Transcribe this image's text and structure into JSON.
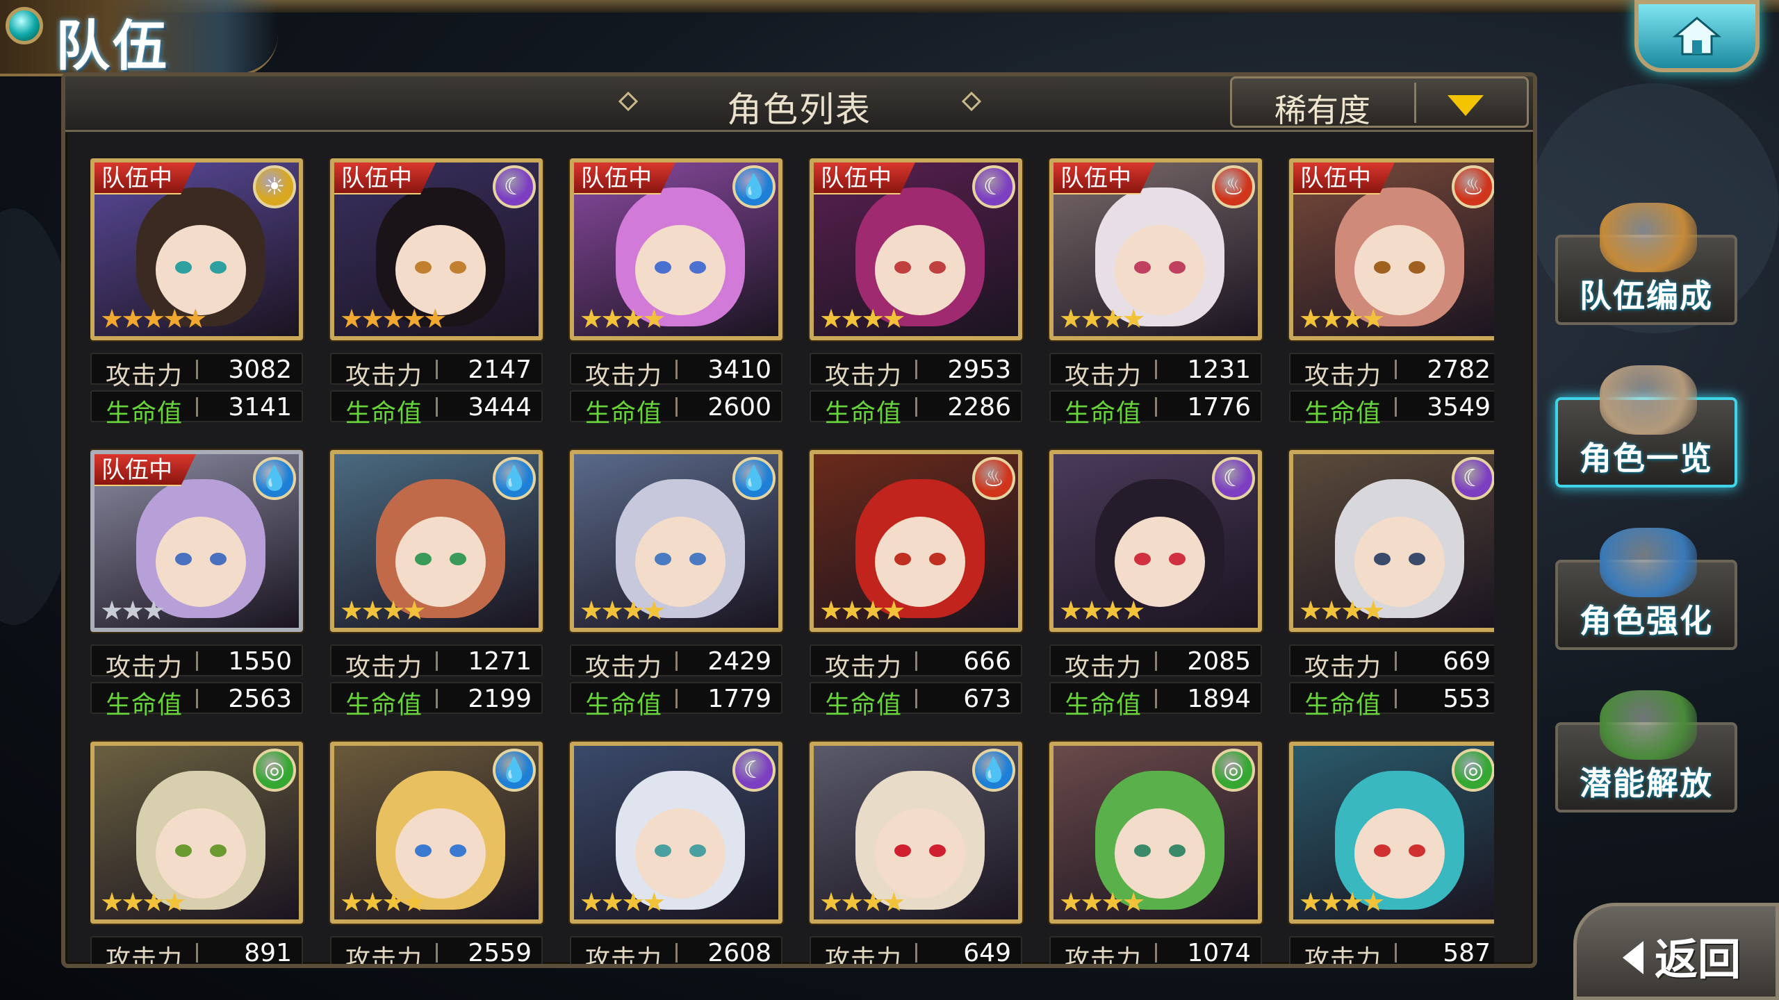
{
  "screen": {
    "title": "队伍"
  },
  "panel": {
    "title": "角色列表",
    "sort_label": "稀有度"
  },
  "party_badge_text": "队伍中",
  "stat_labels": {
    "attack": "攻击力",
    "hp": "生命值"
  },
  "element_icons": {
    "light": "☀",
    "dark": "☾",
    "water": "💧",
    "fire": "♨",
    "wind": "◎"
  },
  "element_colors": {
    "light": "#d9a820",
    "dark": "#7d3fc2",
    "water": "#1e7fd6",
    "fire": "#d0351c",
    "wind": "#34a832"
  },
  "characters": [
    {
      "element": "light",
      "stars": 5,
      "in_party": true,
      "attack": "3082",
      "hp": "3141",
      "hair": "#3a2a22",
      "eye": "#2ea0a0",
      "bg": "#5a4a9a"
    },
    {
      "element": "dark",
      "stars": 5,
      "in_party": true,
      "attack": "2147",
      "hp": "3444",
      "hair": "#1a1418",
      "eye": "#c08030",
      "bg": "#3a3060"
    },
    {
      "element": "water",
      "stars": 4,
      "in_party": true,
      "attack": "3410",
      "hp": "2600",
      "hair": "#d27ad8",
      "eye": "#4a70d0",
      "bg": "#8a4aa0"
    },
    {
      "element": "dark",
      "stars": 4,
      "in_party": true,
      "attack": "2953",
      "hp": "2286",
      "hair": "#a02a70",
      "eye": "#c04040",
      "bg": "#5a2050"
    },
    {
      "element": "fire",
      "stars": 4,
      "in_party": true,
      "attack": "1231",
      "hp": "1776",
      "hair": "#e8dfe6",
      "eye": "#c04060",
      "bg": "#7a6a6a"
    },
    {
      "element": "fire",
      "stars": 4,
      "in_party": true,
      "attack": "2782",
      "hp": "3549",
      "hair": "#d08a7a",
      "eye": "#a06020",
      "bg": "#7a4a3a"
    },
    {
      "element": "water",
      "stars": 3,
      "in_party": true,
      "attack": "1550",
      "hp": "2563",
      "hair": "#b7a0d8",
      "eye": "#4a70c0",
      "bg": "#8a8aa0",
      "silver": true
    },
    {
      "element": "water",
      "stars": 4,
      "in_party": false,
      "attack": "1271",
      "hp": "2199",
      "hair": "#c06a4a",
      "eye": "#3a9a5a",
      "bg": "#4a6a80"
    },
    {
      "element": "water",
      "stars": 4,
      "in_party": false,
      "attack": "2429",
      "hp": "1779",
      "hair": "#c8c8dc",
      "eye": "#4a7ac0",
      "bg": "#5a6a8a"
    },
    {
      "element": "fire",
      "stars": 4,
      "in_party": false,
      "attack": "666",
      "hp": "673",
      "hair": "#c0241c",
      "eye": "#c03020",
      "bg": "#6a2a1a"
    },
    {
      "element": "dark",
      "stars": 4,
      "in_party": false,
      "attack": "2085",
      "hp": "1894",
      "hair": "#241c2a",
      "eye": "#d03040",
      "bg": "#4a3a5a"
    },
    {
      "element": "dark",
      "stars": 4,
      "in_party": false,
      "attack": "669",
      "hp": "553",
      "hair": "#d8d8dc",
      "eye": "#3a4a6a",
      "bg": "#5a4a3a"
    },
    {
      "element": "wind",
      "stars": 4,
      "in_party": false,
      "attack": "891",
      "hp": "",
      "hair": "#d8cfae",
      "eye": "#6a9a30",
      "bg": "#6a6040"
    },
    {
      "element": "water",
      "stars": 4,
      "in_party": false,
      "attack": "2559",
      "hp": "",
      "hair": "#e8c060",
      "eye": "#3a7ad0",
      "bg": "#6a5a3a"
    },
    {
      "element": "dark",
      "stars": 4,
      "in_party": false,
      "attack": "2608",
      "hp": "",
      "hair": "#dfe4ee",
      "eye": "#4aa0a0",
      "bg": "#3a4a6a"
    },
    {
      "element": "water",
      "stars": 4,
      "in_party": false,
      "attack": "649",
      "hp": "",
      "hair": "#e8dcc8",
      "eye": "#d02030",
      "bg": "#5a5a6a"
    },
    {
      "element": "wind",
      "stars": 4,
      "in_party": false,
      "attack": "1074",
      "hp": "",
      "hair": "#5ab04a",
      "eye": "#3a8a6a",
      "bg": "#6a4a4a"
    },
    {
      "element": "wind",
      "stars": 4,
      "in_party": false,
      "attack": "587",
      "hp": "",
      "hair": "#3ab8c0",
      "eye": "#d03030",
      "bg": "#2a5a6a"
    }
  ],
  "side_menu": [
    {
      "label": "队伍编成",
      "art": "#c48a3a",
      "active": false
    },
    {
      "label": "角色一览",
      "art": "#b49a7a",
      "active": true
    },
    {
      "label": "角色强化",
      "art": "#3a7ab8",
      "active": false
    },
    {
      "label": "潜能解放",
      "art": "#4a8a3a",
      "active": false
    }
  ],
  "back_label": "返回"
}
